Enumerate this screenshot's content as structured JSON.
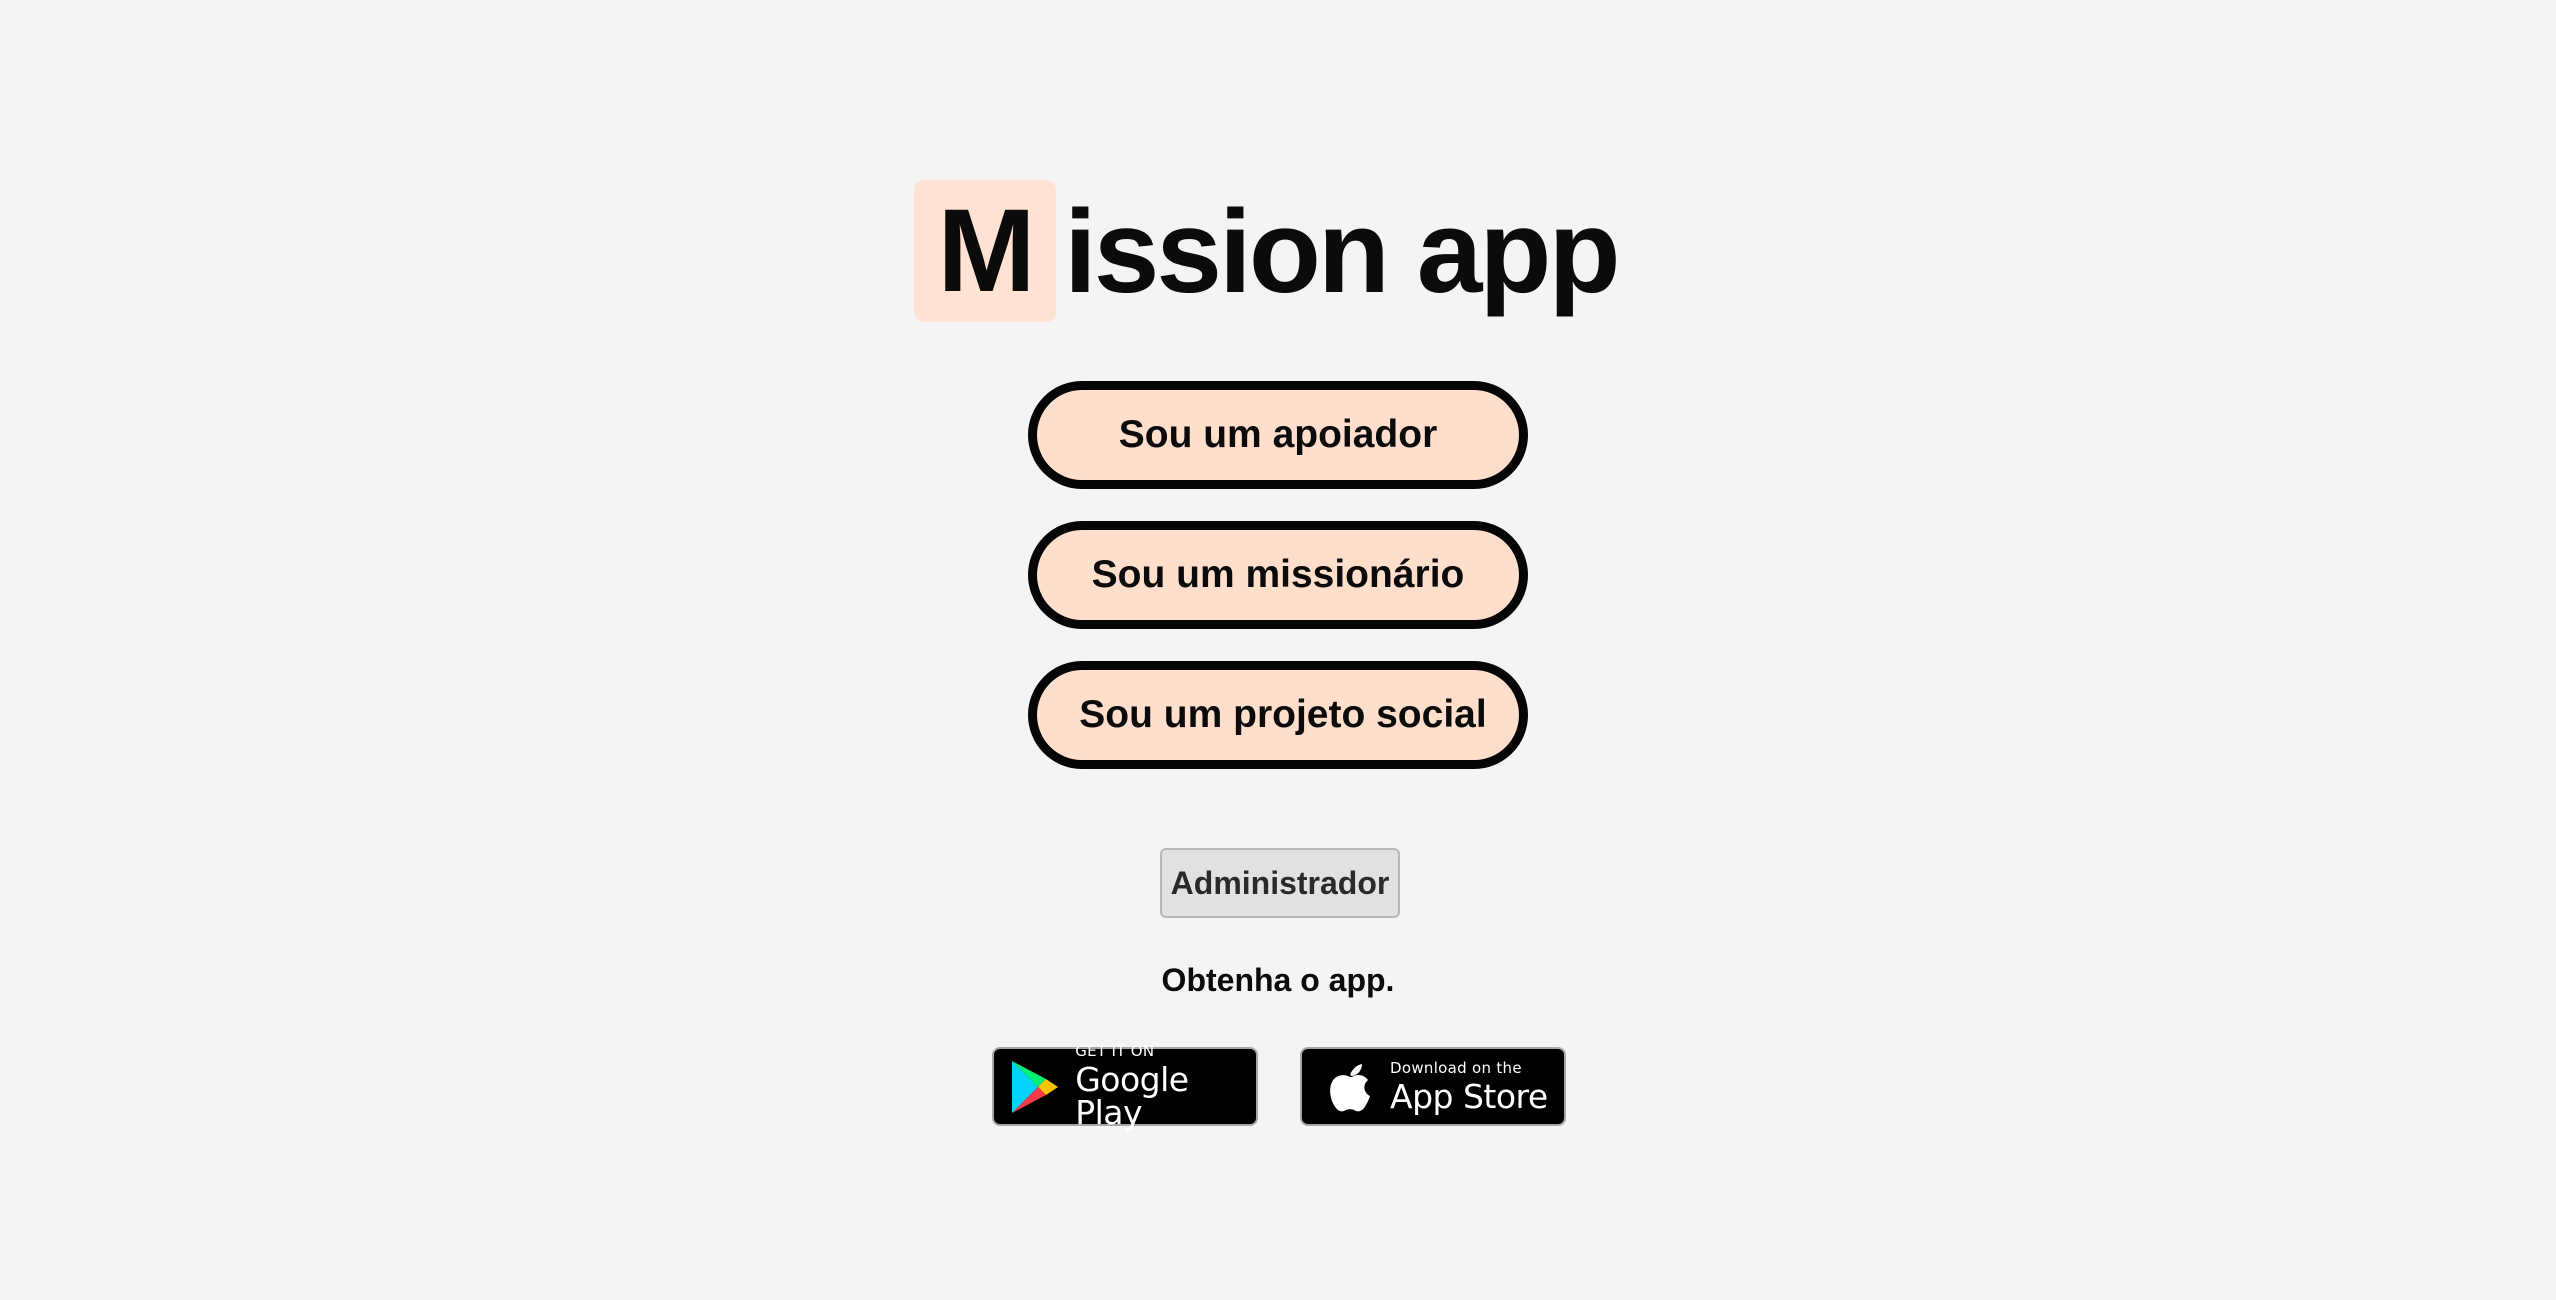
{
  "logo": {
    "mark_letter": "M",
    "rest": "ission app"
  },
  "roles": {
    "supporter": "Sou um apoiador",
    "missionary": "Sou um missionário",
    "social_project": "Sou um projeto social"
  },
  "admin_label": "Administrador",
  "get_app_text": "Obtenha o app.",
  "badges": {
    "google_small": "GET IT ON",
    "google_big": "Google Play",
    "apple_small": "Download on the",
    "apple_big": "App Store"
  },
  "colors": {
    "background": "#f4f4f4",
    "accent": "#ffdfcb",
    "logo_mark_bg": "#ffe2d4",
    "button_border": "#050505"
  },
  "icons": {
    "google": "google-play-icon",
    "apple": "apple-icon"
  }
}
